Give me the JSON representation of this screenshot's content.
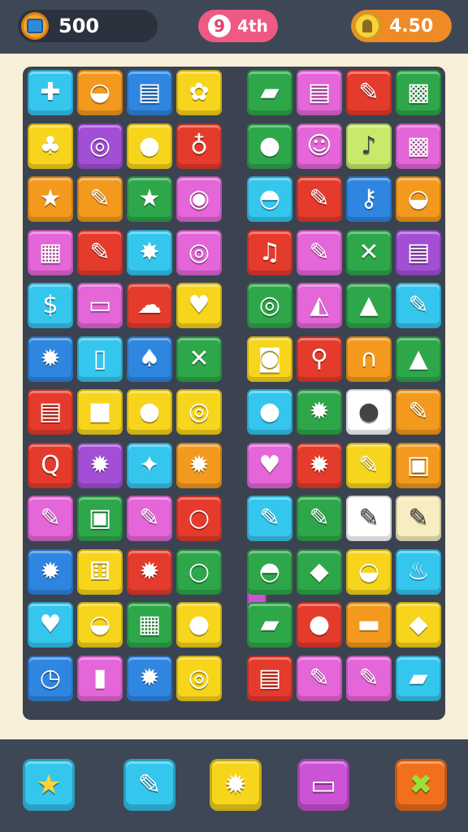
{
  "hud": {
    "coins": "500",
    "moves_badge": "9",
    "moves": "4th",
    "score": "4.50"
  },
  "board": {
    "left": [
      [
        {
          "color": "#35c6ee",
          "icon": "plus-icon",
          "glyph": "✚"
        },
        {
          "color": "#f39a1e",
          "icon": "bowl-icon",
          "glyph": "◒"
        },
        {
          "color": "#2f86e0",
          "icon": "stack-icon",
          "glyph": "▤"
        },
        {
          "color": "#f7d51c",
          "icon": "flower-icon",
          "glyph": "✿"
        }
      ],
      [
        {
          "color": "#f7d51c",
          "icon": "plant-pot-icon",
          "glyph": "♣"
        },
        {
          "color": "#a24fd6",
          "icon": "ring-icon",
          "glyph": "◎"
        },
        {
          "color": "#f7d51c",
          "icon": "apple-icon",
          "glyph": "●"
        },
        {
          "color": "#e53b2c",
          "icon": "bulb-icon",
          "glyph": "♁"
        }
      ],
      [
        {
          "color": "#f39a1e",
          "icon": "star-icon",
          "glyph": "★"
        },
        {
          "color": "#f39a1e",
          "icon": "brush-icon",
          "glyph": "✎"
        },
        {
          "color": "#2ea74a",
          "icon": "star-icon",
          "glyph": "★"
        },
        {
          "color": "#e466d8",
          "icon": "camera-icon",
          "glyph": "◉"
        }
      ],
      [
        {
          "color": "#e466d8",
          "icon": "document-icon",
          "glyph": "▦"
        },
        {
          "color": "#e53b2c",
          "icon": "pencil-icon",
          "glyph": "✎"
        },
        {
          "color": "#35c6ee",
          "icon": "burst-icon",
          "glyph": "✸"
        },
        {
          "color": "#e466d8",
          "icon": "ring-icon",
          "glyph": "◎"
        }
      ],
      [
        {
          "color": "#35c6ee",
          "icon": "money-icon",
          "glyph": "$"
        },
        {
          "color": "#e466d8",
          "icon": "monitor-icon",
          "glyph": "▭"
        },
        {
          "color": "#e53b2c",
          "icon": "cloud-icon",
          "glyph": "☁"
        },
        {
          "color": "#f7d51c",
          "icon": "heart-icon",
          "glyph": "♥"
        }
      ],
      [
        {
          "color": "#2f86e0",
          "icon": "gear-icon",
          "glyph": "✹"
        },
        {
          "color": "#35c6ee",
          "icon": "phone-icon",
          "glyph": "▯"
        },
        {
          "color": "#2f86e0",
          "icon": "mushroom-icon",
          "glyph": "♠"
        },
        {
          "color": "#2ea74a",
          "icon": "cross-icon",
          "glyph": "✕"
        }
      ],
      [
        {
          "color": "#e53b2c",
          "icon": "document-icon",
          "glyph": "▤"
        },
        {
          "color": "#f7d51c",
          "icon": "box-icon",
          "glyph": "■"
        },
        {
          "color": "#f7d51c",
          "icon": "apple-icon",
          "glyph": "●"
        },
        {
          "color": "#f7d51c",
          "icon": "ring-icon",
          "glyph": "◎"
        }
      ],
      [
        {
          "color": "#e53b2c",
          "icon": "magnifier-icon",
          "glyph": "Q"
        },
        {
          "color": "#a24fd6",
          "icon": "gear-icon",
          "glyph": "✹"
        },
        {
          "color": "#35c6ee",
          "icon": "pin-icon",
          "glyph": "✦"
        },
        {
          "color": "#f39a1e",
          "icon": "gear-icon",
          "glyph": "✹"
        }
      ],
      [
        {
          "color": "#e466d8",
          "icon": "crayon-icon",
          "glyph": "✎"
        },
        {
          "color": "#2ea74a",
          "icon": "target-icon",
          "glyph": "▣"
        },
        {
          "color": "#e466d8",
          "icon": "pencil-icon",
          "glyph": "✎"
        },
        {
          "color": "#e53b2c",
          "icon": "ring-icon",
          "glyph": "○"
        }
      ],
      [
        {
          "color": "#2f86e0",
          "icon": "gear-icon",
          "glyph": "✹"
        },
        {
          "color": "#f7d51c",
          "icon": "dice-icon",
          "glyph": "⚅"
        },
        {
          "color": "#e53b2c",
          "icon": "gear-icon",
          "glyph": "✹"
        },
        {
          "color": "#2ea74a",
          "icon": "ring-icon",
          "glyph": "○"
        }
      ],
      [
        {
          "color": "#35c6ee",
          "icon": "heart-icon",
          "glyph": "♥"
        },
        {
          "color": "#f7d51c",
          "icon": "bowl-icon",
          "glyph": "◒"
        },
        {
          "color": "#2ea74a",
          "icon": "cake-icon",
          "glyph": "▦"
        },
        {
          "color": "#f7d51c",
          "icon": "pumpkin-icon",
          "glyph": "●"
        }
      ],
      [
        {
          "color": "#2f86e0",
          "icon": "clock-icon",
          "glyph": "◷"
        },
        {
          "color": "#e466d8",
          "icon": "battery-icon",
          "glyph": "▮"
        },
        {
          "color": "#2f86e0",
          "icon": "gear-icon",
          "glyph": "✹"
        },
        {
          "color": "#f7d51c",
          "icon": "ring-icon",
          "glyph": "◎"
        }
      ]
    ],
    "right": [
      [
        {
          "color": "#2ea74a",
          "icon": "eraser-icon",
          "glyph": "▰"
        },
        {
          "color": "#e466d8",
          "icon": "money-stack-icon",
          "glyph": "▤"
        },
        {
          "color": "#e53b2c",
          "icon": "pencil-icon",
          "glyph": "✎"
        },
        {
          "color": "#2ea74a",
          "icon": "crate-icon",
          "glyph": "▩"
        }
      ],
      [
        {
          "color": "#2ea74a",
          "icon": "ball-icon",
          "glyph": "●"
        },
        {
          "color": "#e466d8",
          "icon": "face-icon",
          "glyph": "☺"
        },
        {
          "color": "#c8ea6a",
          "icon": "lollipop-icon",
          "glyph": "♪"
        },
        {
          "color": "#e466d8",
          "icon": "cube-icon",
          "glyph": "▩"
        }
      ],
      [
        {
          "color": "#35c6ee",
          "icon": "cake-icon",
          "glyph": "◓"
        },
        {
          "color": "#e53b2c",
          "icon": "pencil-icon",
          "glyph": "✎"
        },
        {
          "color": "#2f86e0",
          "icon": "key-icon",
          "glyph": "⚷"
        },
        {
          "color": "#f39a1e",
          "icon": "bucket-icon",
          "glyph": "◒"
        }
      ],
      [
        {
          "color": "#e53b2c",
          "icon": "bell-icon",
          "glyph": "♫"
        },
        {
          "color": "#e466d8",
          "icon": "tool-icon",
          "glyph": "✎"
        },
        {
          "color": "#2ea74a",
          "icon": "cross-icon",
          "glyph": "✕"
        },
        {
          "color": "#a24fd6",
          "icon": "book-stack-icon",
          "glyph": "▤"
        }
      ],
      [
        {
          "color": "#2ea74a",
          "icon": "ring-icon",
          "glyph": "◎"
        },
        {
          "color": "#e466d8",
          "icon": "shell-icon",
          "glyph": "◭"
        },
        {
          "color": "#2ea74a",
          "icon": "bread-icon",
          "glyph": "▲"
        },
        {
          "color": "#35c6ee",
          "icon": "pencil-icon",
          "glyph": "✎"
        }
      ],
      [
        {
          "color": "#f7d51c",
          "icon": "capsule-icon",
          "glyph": "◙"
        },
        {
          "color": "#e53b2c",
          "icon": "magnifier-icon",
          "glyph": "⚲"
        },
        {
          "color": "#f39a1e",
          "icon": "horseshoe-icon",
          "glyph": "∩"
        },
        {
          "color": "#2ea74a",
          "icon": "triangle-icon",
          "glyph": "▲"
        }
      ],
      [
        {
          "color": "#35c6ee",
          "icon": "apple-icon",
          "glyph": "●"
        },
        {
          "color": "#2ea74a",
          "icon": "gear-icon",
          "glyph": "✹"
        },
        {
          "color": "#ffffff",
          "icon": "monster-icon",
          "glyph": "●"
        },
        {
          "color": "#f39a1e",
          "icon": "brush-icon",
          "glyph": "✎"
        }
      ],
      [
        {
          "color": "#e466d8",
          "icon": "heart-icon",
          "glyph": "♥"
        },
        {
          "color": "#e53b2c",
          "icon": "gear-icon",
          "glyph": "✹"
        },
        {
          "color": "#f7d51c",
          "icon": "crayon-icon",
          "glyph": "✎"
        },
        {
          "color": "#f39a1e",
          "icon": "tablet-icon",
          "glyph": "▣"
        }
      ],
      [
        {
          "color": "#35c6ee",
          "icon": "pen-icon",
          "glyph": "✎"
        },
        {
          "color": "#2ea74a",
          "icon": "pencil-icon",
          "glyph": "✎"
        },
        {
          "color": "#ffffff",
          "icon": "marker-icon",
          "glyph": "✎"
        },
        {
          "color": "#f7edc0",
          "icon": "brush-icon",
          "glyph": "✎"
        }
      ],
      [
        {
          "color": "#2ea74a",
          "icon": "shell-icon",
          "glyph": "◓"
        },
        {
          "color": "#2ea74a",
          "icon": "eraser-icon",
          "glyph": "◆"
        },
        {
          "color": "#f7d51c",
          "icon": "bowl-icon",
          "glyph": "◒"
        },
        {
          "color": "#35c6ee",
          "icon": "fire-icon",
          "glyph": "♨"
        }
      ],
      [
        {
          "color": "#2ea74a",
          "icon": "eraser-icon",
          "glyph": "▰"
        },
        {
          "color": "#e53b2c",
          "icon": "ball-icon",
          "glyph": "●"
        },
        {
          "color": "#f39a1e",
          "icon": "soap-icon",
          "glyph": "▬"
        },
        {
          "color": "#f7d51c",
          "icon": "gem-icon",
          "glyph": "◆"
        }
      ],
      [
        {
          "color": "#e53b2c",
          "icon": "paper-stack-icon",
          "glyph": "▤"
        },
        {
          "color": "#e466d8",
          "icon": "pencil-icon",
          "glyph": "✎"
        },
        {
          "color": "#e466d8",
          "icon": "syringe-icon",
          "glyph": "✎"
        },
        {
          "color": "#35c6ee",
          "icon": "cheese-icon",
          "glyph": "▰"
        }
      ]
    ]
  },
  "tools": [
    {
      "name": "star-tool",
      "color": "#35c6ee",
      "icon": "star-icon",
      "glyph": "★"
    },
    {
      "name": "brush-tool",
      "color": "#35c6ee",
      "icon": "brush-icon",
      "glyph": "✎"
    },
    {
      "name": "gear-tool",
      "color": "#f7d51c",
      "icon": "gear-icon",
      "glyph": "✹"
    },
    {
      "name": "chat-tool",
      "color": "#cc52d6",
      "icon": "chat-bubble-icon",
      "glyph": "▭"
    },
    {
      "name": "shuffle-tool",
      "color": "#f0701e",
      "icon": "cross-icon",
      "glyph": "✖"
    }
  ]
}
